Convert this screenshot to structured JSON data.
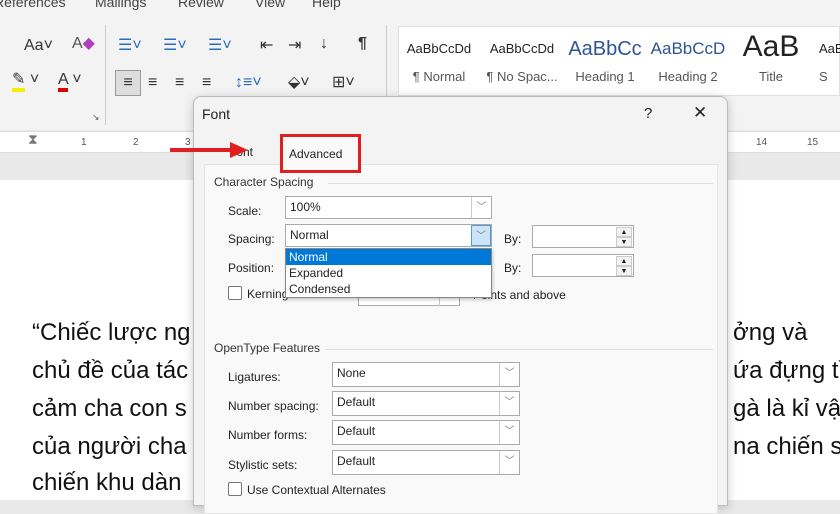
{
  "ribbon": {
    "tabs": [
      "References",
      "Mailings",
      "Review",
      "View",
      "Help"
    ],
    "styles": [
      {
        "preview": "AaBbCcDd",
        "name": "¶ Normal"
      },
      {
        "preview": "AaBbCcDd",
        "name": "¶ No Spac..."
      },
      {
        "preview": "AaBbCc",
        "name": "Heading 1"
      },
      {
        "preview": "AaBbCcD",
        "name": "Heading 2"
      },
      {
        "preview": "AaB",
        "name": "Title"
      },
      {
        "preview": "AaB",
        "name": "S"
      }
    ]
  },
  "ruler": {
    "marks": [
      "1",
      "2",
      "3",
      "14",
      "15"
    ]
  },
  "document": {
    "lines_left": [
      "“Chiếc lược ng",
      "chủ đề của tác",
      "cảm cha con s",
      "của người cha",
      "chiến khu dàn"
    ],
    "lines_right": [
      "ởng và",
      "ứa đựng tìn",
      "gà là kỉ vậ",
      "na chiến sĩ",
      ""
    ]
  },
  "dialog": {
    "title": "Font",
    "help": "?",
    "close": "✕",
    "tabs": [
      "Font",
      "Advanced"
    ],
    "active_tab": "Advanced",
    "highlight_color": "#e02020",
    "character_spacing": {
      "heading": "Character Spacing",
      "scale_label": "Scale:",
      "scale_value": "100%",
      "spacing_label": "Spacing:",
      "spacing_value": "Normal",
      "spacing_options": [
        "Normal",
        "Expanded",
        "Condensed"
      ],
      "by_label": "By:",
      "position_label": "Position:",
      "position_by_label": "By:",
      "kerning_label": "Kerning for fonts:",
      "points_label": "Points and above"
    },
    "opentype": {
      "heading": "OpenType Features",
      "ligatures_label": "Ligatures:",
      "ligatures_value": "None",
      "number_spacing_label": "Number spacing:",
      "number_spacing_value": "Default",
      "number_forms_label": "Number forms:",
      "number_forms_value": "Default",
      "stylistic_label": "Stylistic sets:",
      "stylistic_value": "Default",
      "contextual_label": "Use Contextual Alternates"
    }
  }
}
